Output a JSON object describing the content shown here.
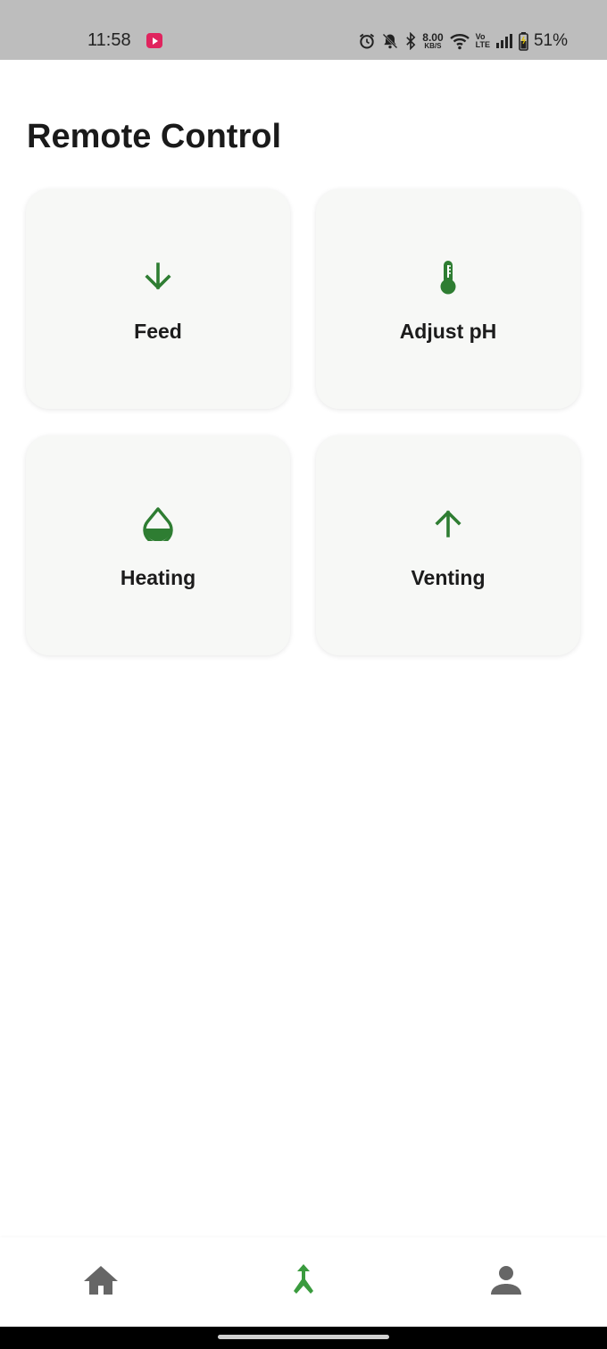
{
  "status_bar": {
    "time": "11:58",
    "net_speed_value": "8.00",
    "net_speed_unit": "KB/S",
    "volte_top": "Vo",
    "volte_bottom": "LTE",
    "battery": "51%",
    "icons": [
      "youtube-notification-icon",
      "alarm-icon",
      "notifications-off-icon",
      "bluetooth-icon",
      "wifi-icon",
      "signal-icon",
      "battery-icon"
    ]
  },
  "page": {
    "title": "Remote Control"
  },
  "controls": [
    {
      "label": "Feed",
      "icon": "arrow-down-icon"
    },
    {
      "label": "Adjust pH",
      "icon": "thermometer-icon"
    },
    {
      "label": "Heating",
      "icon": "water-drop-icon"
    },
    {
      "label": "Venting",
      "icon": "arrow-up-icon"
    }
  ],
  "bottom_nav": {
    "items": [
      {
        "icon": "home-icon",
        "active": false
      },
      {
        "icon": "merge-icon",
        "active": true
      },
      {
        "icon": "person-icon",
        "active": false
      }
    ]
  },
  "colors": {
    "accent": "#2e7d32",
    "nav_active": "#3a9b3e",
    "nav_inactive": "#666666",
    "card_bg": "#f7f8f6",
    "status_bar_bg": "#bdbdbd"
  }
}
